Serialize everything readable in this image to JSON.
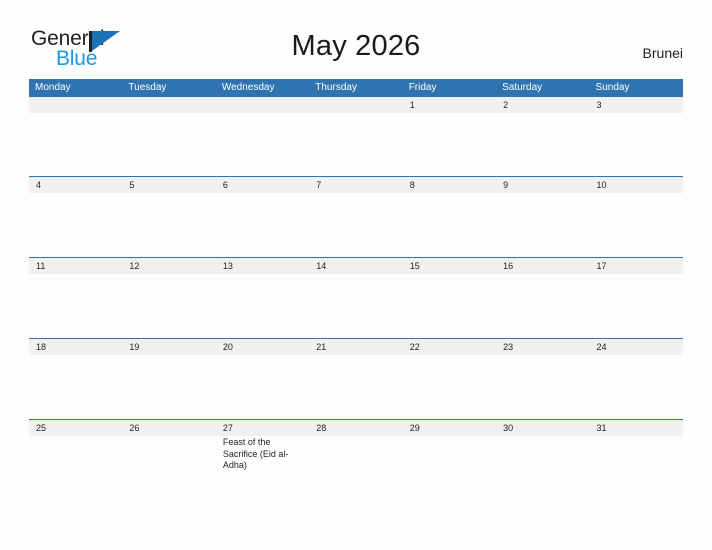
{
  "brand": {
    "name_part1": "General",
    "name_part2": "Blue",
    "icon": "flag-triangle-icon",
    "color_dark": "#231f20",
    "color_blue": "#1b9ae0",
    "color_flag": "#1b72bb"
  },
  "header": {
    "title": "May 2026",
    "country": "Brunei"
  },
  "theme": {
    "header_blue": "#2f73b0",
    "date_band": "#f0f0f0",
    "page_background": "#fdfdfd",
    "text": "#231f20"
  },
  "calendar": {
    "weekdays": [
      "Monday",
      "Tuesday",
      "Wednesday",
      "Thursday",
      "Friday",
      "Saturday",
      "Sunday"
    ],
    "weeks": [
      [
        {
          "date": "",
          "event": ""
        },
        {
          "date": "",
          "event": ""
        },
        {
          "date": "",
          "event": ""
        },
        {
          "date": "",
          "event": ""
        },
        {
          "date": "1",
          "event": ""
        },
        {
          "date": "2",
          "event": ""
        },
        {
          "date": "3",
          "event": ""
        }
      ],
      [
        {
          "date": "4",
          "event": ""
        },
        {
          "date": "5",
          "event": ""
        },
        {
          "date": "6",
          "event": ""
        },
        {
          "date": "7",
          "event": ""
        },
        {
          "date": "8",
          "event": ""
        },
        {
          "date": "9",
          "event": ""
        },
        {
          "date": "10",
          "event": ""
        }
      ],
      [
        {
          "date": "11",
          "event": ""
        },
        {
          "date": "12",
          "event": ""
        },
        {
          "date": "13",
          "event": ""
        },
        {
          "date": "14",
          "event": ""
        },
        {
          "date": "15",
          "event": ""
        },
        {
          "date": "16",
          "event": ""
        },
        {
          "date": "17",
          "event": ""
        }
      ],
      [
        {
          "date": "18",
          "event": ""
        },
        {
          "date": "19",
          "event": ""
        },
        {
          "date": "20",
          "event": ""
        },
        {
          "date": "21",
          "event": ""
        },
        {
          "date": "22",
          "event": ""
        },
        {
          "date": "23",
          "event": ""
        },
        {
          "date": "24",
          "event": ""
        }
      ],
      [
        {
          "date": "25",
          "event": ""
        },
        {
          "date": "26",
          "event": ""
        },
        {
          "date": "27",
          "event": "Feast of the Sacrifice (Eid al-Adha)"
        },
        {
          "date": "28",
          "event": ""
        },
        {
          "date": "29",
          "event": ""
        },
        {
          "date": "30",
          "event": ""
        },
        {
          "date": "31",
          "event": ""
        }
      ]
    ]
  }
}
